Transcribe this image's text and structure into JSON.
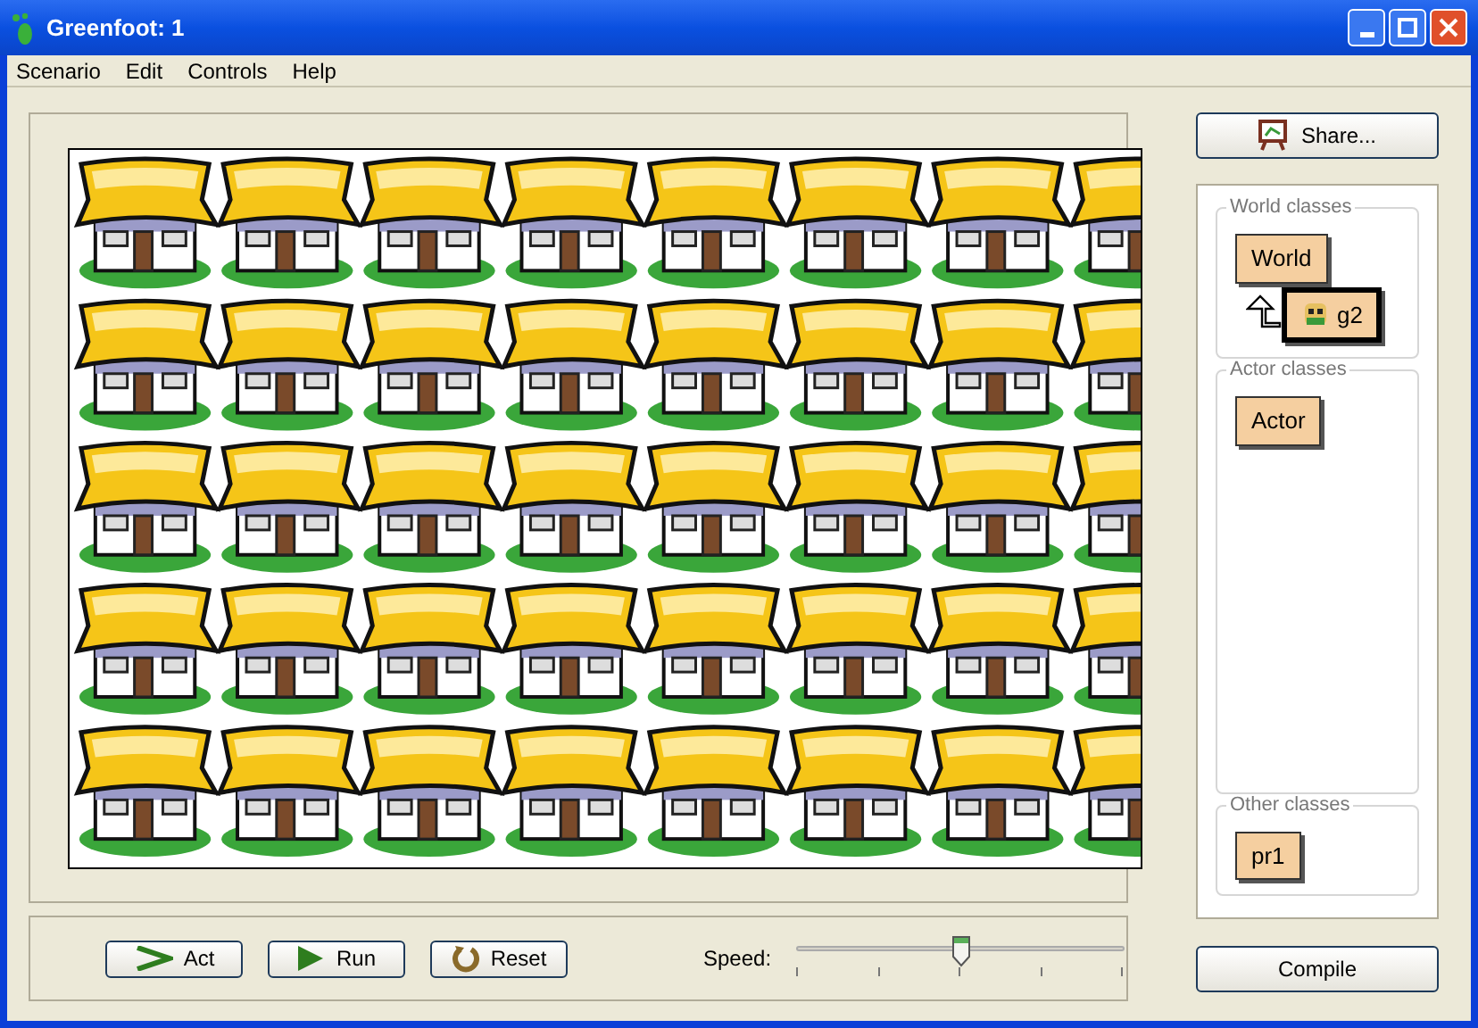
{
  "window": {
    "title": "Greenfoot: 1"
  },
  "menu": [
    "Scenario",
    "Edit",
    "Controls",
    "Help"
  ],
  "share_button": "Share...",
  "class_groups": [
    {
      "title": "World classes",
      "classes": [
        {
          "name": "World",
          "selected": false,
          "children": [
            {
              "name": "g2",
              "selected": true,
              "icon": true
            }
          ]
        }
      ]
    },
    {
      "title": "Actor classes",
      "classes": [
        {
          "name": "Actor",
          "selected": false
        }
      ]
    },
    {
      "title": "Other classes",
      "classes": [
        {
          "name": "pr1",
          "selected": false
        }
      ]
    }
  ],
  "controls": {
    "buttons": [
      {
        "kind": "act",
        "label": "Act"
      },
      {
        "kind": "run",
        "label": "Run"
      },
      {
        "kind": "reset",
        "label": "Reset"
      }
    ],
    "speed": {
      "label": "Speed:",
      "level": 0.5
    },
    "compile_button": "Compile"
  }
}
